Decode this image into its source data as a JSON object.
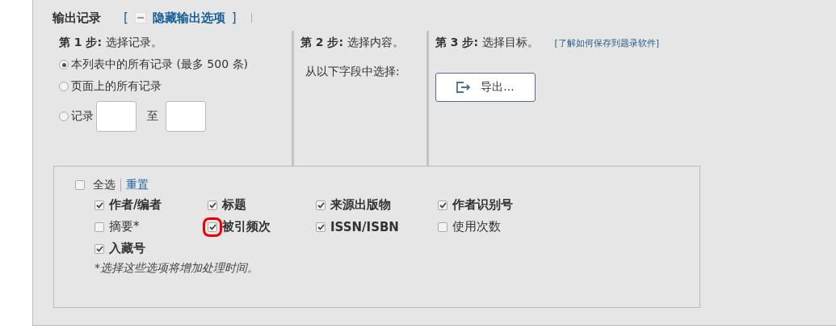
{
  "header": {
    "title": "输出记录",
    "toggle": {
      "open": "[",
      "label": "隐藏输出选项",
      "close": "]"
    }
  },
  "step1": {
    "heading": "**第 1 步:** 选择记录。",
    "options": [
      {
        "label": "本列表中的所有记录 (最多 500 条)",
        "selected": true,
        "kind": "plain"
      },
      {
        "label": "页面上的所有记录",
        "selected": false,
        "kind": "plain"
      },
      {
        "label": "记录",
        "selected": false,
        "kind": "range",
        "between": "至"
      }
    ]
  },
  "step2": {
    "heading": "**第 2 步:** 选择内容。",
    "hint": "从以下字段中选择:"
  },
  "step3": {
    "heading": "**第 3 步:** 选择目标。",
    "help_link": "[了解如何保存到题录软件]",
    "button": "导出..."
  },
  "fields": {
    "select_all": {
      "label": "全选",
      "checked": false
    },
    "reset": "重置",
    "items": [
      {
        "label": "作者/编者",
        "checked": true,
        "highlighted": false
      },
      {
        "label": "标题",
        "checked": true,
        "highlighted": false
      },
      {
        "label": "来源出版物",
        "checked": true,
        "highlighted": false
      },
      {
        "label": "作者识别号",
        "checked": true,
        "highlighted": false
      },
      {
        "label": "摘要*",
        "checked": false,
        "highlighted": false
      },
      {
        "label": "被引频次",
        "checked": true,
        "highlighted": true
      },
      {
        "label": "ISSN/ISBN",
        "checked": true,
        "highlighted": false
      },
      {
        "label": "使用次数",
        "checked": false,
        "highlighted": false
      },
      {
        "label": "入藏号",
        "checked": true,
        "highlighted": false
      }
    ],
    "note": "*选择这些选项将增加处理时间。"
  }
}
